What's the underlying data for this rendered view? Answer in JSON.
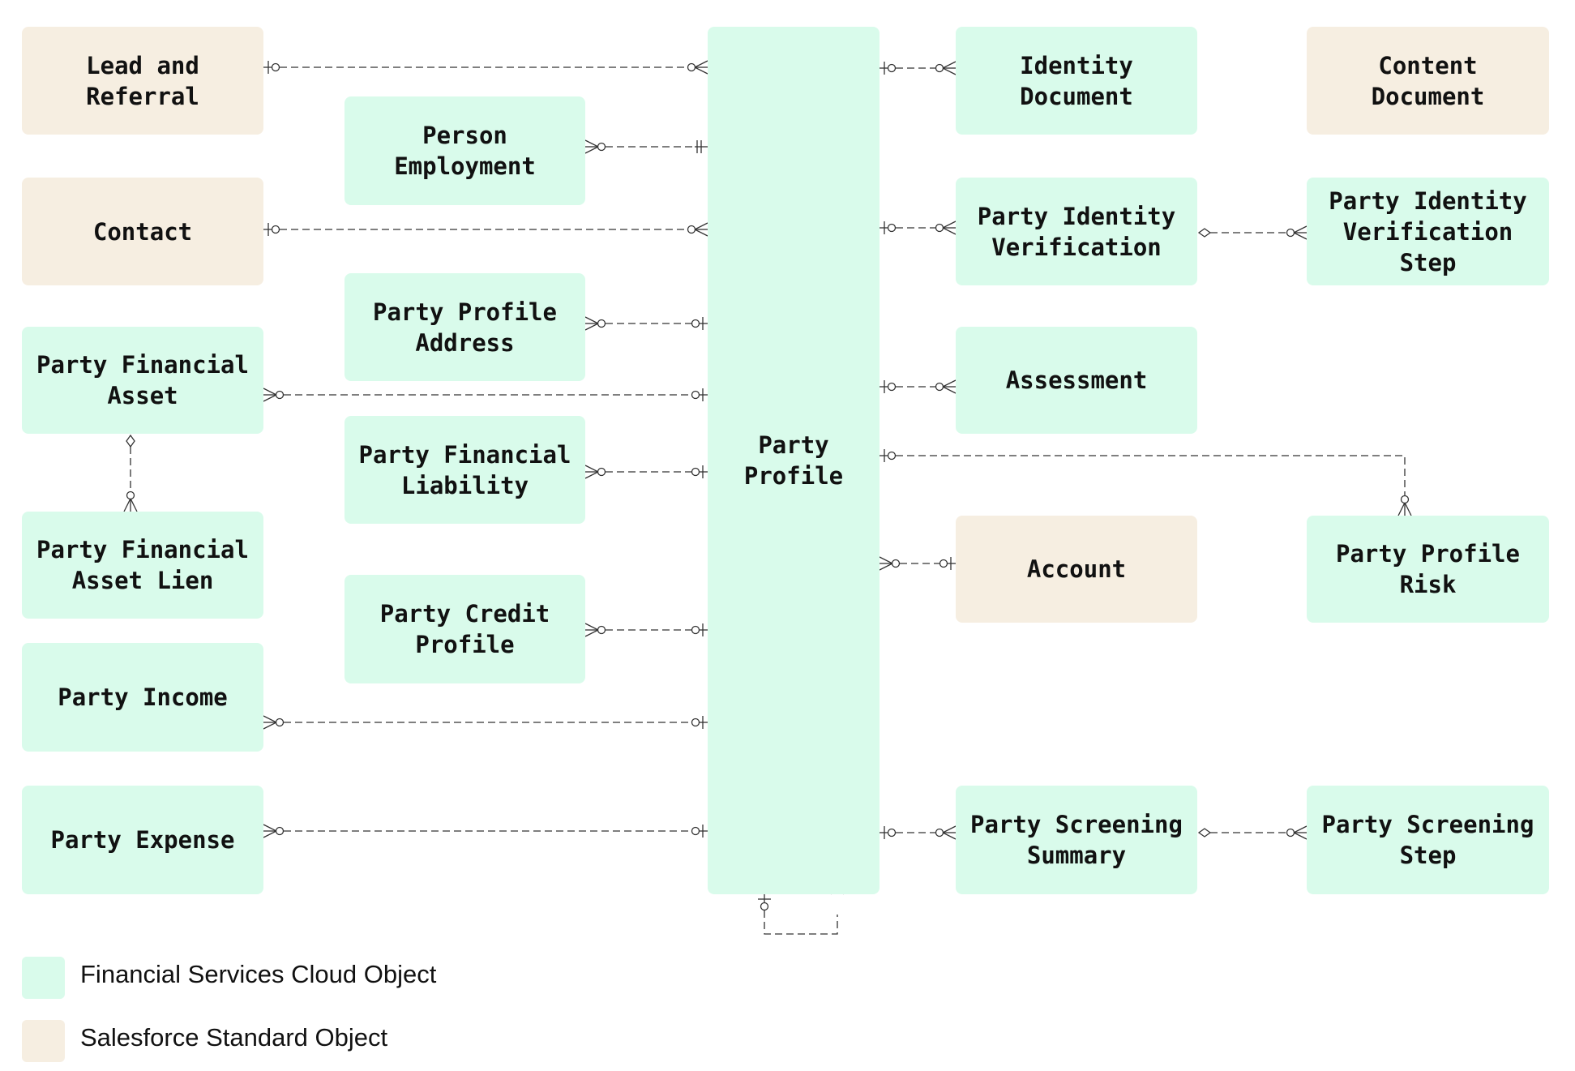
{
  "colors": {
    "fsc_object": "#d9fbeb",
    "standard_object": "#f6eee1",
    "line": "#333333"
  },
  "entities": {
    "lead_and_referral": {
      "label": "Lead and\nReferral",
      "type": "standard"
    },
    "person_employment": {
      "label": "Person\nEmployment",
      "type": "fsc"
    },
    "contact": {
      "label": "Contact",
      "type": "standard"
    },
    "party_profile_address": {
      "label": "Party Profile\nAddress",
      "type": "fsc"
    },
    "party_financial_asset": {
      "label": "Party Financial\nAsset",
      "type": "fsc"
    },
    "party_financial_liability": {
      "label": "Party Financial\nLiability",
      "type": "fsc"
    },
    "party_financial_asset_lien": {
      "label": "Party Financial\nAsset Lien",
      "type": "fsc"
    },
    "party_credit_profile": {
      "label": "Party Credit\nProfile",
      "type": "fsc"
    },
    "party_income": {
      "label": "Party Income",
      "type": "fsc"
    },
    "party_expense": {
      "label": "Party Expense",
      "type": "fsc"
    },
    "party_profile": {
      "label": "Party\nProfile",
      "type": "fsc"
    },
    "identity_document": {
      "label": "Identity\nDocument",
      "type": "fsc"
    },
    "content_document": {
      "label": "Content\nDocument",
      "type": "standard"
    },
    "party_identity_verification": {
      "label": "Party Identity\nVerification",
      "type": "fsc"
    },
    "party_identity_verification_step": {
      "label": "Party Identity\nVerification\nStep",
      "type": "fsc"
    },
    "assessment": {
      "label": "Assessment",
      "type": "fsc"
    },
    "account": {
      "label": "Account",
      "type": "standard"
    },
    "party_profile_risk": {
      "label": "Party Profile\nRisk",
      "type": "fsc"
    },
    "party_screening_summary": {
      "label": "Party Screening\nSummary",
      "type": "fsc"
    },
    "party_screening_step": {
      "label": "Party Screening\nStep",
      "type": "fsc"
    }
  },
  "relationships": [
    {
      "from": "lead_and_referral",
      "to": "party_profile",
      "from_end": "zero-or-one",
      "to_end": "zero-or-many"
    },
    {
      "from": "person_employment",
      "to": "party_profile",
      "from_end": "zero-or-many",
      "to_end": "exactly-one"
    },
    {
      "from": "contact",
      "to": "party_profile",
      "from_end": "zero-or-one",
      "to_end": "zero-or-many"
    },
    {
      "from": "party_profile_address",
      "to": "party_profile",
      "from_end": "zero-or-many",
      "to_end": "zero-or-one"
    },
    {
      "from": "party_financial_asset",
      "to": "party_profile",
      "from_end": "zero-or-many",
      "to_end": "zero-or-one"
    },
    {
      "from": "party_financial_liability",
      "to": "party_profile",
      "from_end": "zero-or-many",
      "to_end": "zero-or-one"
    },
    {
      "from": "party_financial_asset",
      "to": "party_financial_asset_lien",
      "from_end": "aggregation",
      "to_end": "zero-or-many"
    },
    {
      "from": "party_credit_profile",
      "to": "party_profile",
      "from_end": "zero-or-many",
      "to_end": "zero-or-one"
    },
    {
      "from": "party_income",
      "to": "party_profile",
      "from_end": "zero-or-many",
      "to_end": "zero-or-one"
    },
    {
      "from": "party_expense",
      "to": "party_profile",
      "from_end": "zero-or-many",
      "to_end": "zero-or-one"
    },
    {
      "from": "party_profile",
      "to": "identity_document",
      "from_end": "zero-or-one",
      "to_end": "zero-or-many"
    },
    {
      "from": "party_profile",
      "to": "party_identity_verification",
      "from_end": "zero-or-one",
      "to_end": "zero-or-many"
    },
    {
      "from": "party_identity_verification",
      "to": "party_identity_verification_step",
      "from_end": "aggregation",
      "to_end": "zero-or-many"
    },
    {
      "from": "party_profile",
      "to": "assessment",
      "from_end": "zero-or-one",
      "to_end": "zero-or-many"
    },
    {
      "from": "party_profile",
      "to": "party_profile_risk",
      "from_end": "zero-or-one",
      "to_end": "zero-or-many"
    },
    {
      "from": "party_profile",
      "to": "account",
      "from_end": "zero-or-many",
      "to_end": "zero-or-one"
    },
    {
      "from": "party_profile",
      "to": "party_screening_summary",
      "from_end": "zero-or-one",
      "to_end": "zero-or-many"
    },
    {
      "from": "party_screening_summary",
      "to": "party_screening_step",
      "from_end": "aggregation",
      "to_end": "zero-or-many"
    },
    {
      "from": "party_profile",
      "to": "party_profile",
      "from_end": "zero-or-one",
      "to_end": "zero-or-many"
    }
  ],
  "legend": {
    "fsc_label": "Financial Services Cloud Object",
    "standard_label": "Salesforce Standard Object"
  }
}
